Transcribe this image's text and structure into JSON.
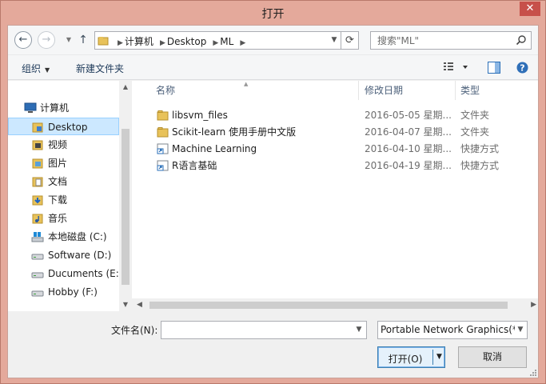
{
  "window": {
    "title": "打开",
    "close_glyph": "✕"
  },
  "address": {
    "crumbs": [
      "计算机",
      "Desktop",
      "ML"
    ],
    "search_placeholder": "搜索\"ML\""
  },
  "toolbar": {
    "organize_label": "组织",
    "new_folder_label": "新建文件夹"
  },
  "navpane": {
    "items": [
      {
        "label": "计算机",
        "icon": "computer-icon"
      },
      {
        "label": "Desktop",
        "icon": "folder-desktop-icon",
        "selected": true
      },
      {
        "label": "视频",
        "icon": "videos-folder-icon"
      },
      {
        "label": "图片",
        "icon": "pictures-folder-icon"
      },
      {
        "label": "文档",
        "icon": "documents-folder-icon"
      },
      {
        "label": "下载",
        "icon": "downloads-folder-icon"
      },
      {
        "label": "音乐",
        "icon": "music-folder-icon"
      },
      {
        "label": "本地磁盘 (C:)",
        "icon": "system-drive-icon"
      },
      {
        "label": "Software (D:)",
        "icon": "drive-icon"
      },
      {
        "label": "Ducuments (E:)",
        "icon": "drive-icon"
      },
      {
        "label": "Hobby (F:)",
        "icon": "drive-icon"
      }
    ]
  },
  "filelist": {
    "columns": {
      "name": "名称",
      "date": "修改日期",
      "type": "类型"
    },
    "rows": [
      {
        "name": "libsvm_files",
        "date": "2016-05-05 星期...",
        "type": "文件夹",
        "icon": "folder-icon"
      },
      {
        "name": "Scikit-learn 使用手册中文版",
        "date": "2016-04-07 星期...",
        "type": "文件夹",
        "icon": "folder-icon"
      },
      {
        "name": "Machine Learning",
        "date": "2016-04-10 星期...",
        "type": "快捷方式",
        "icon": "shortcut-icon"
      },
      {
        "name": "R语言基础",
        "date": "2016-04-19 星期...",
        "type": "快捷方式",
        "icon": "shortcut-icon"
      }
    ]
  },
  "bottom": {
    "filename_label": "文件名(N):",
    "filename_value": "",
    "filetype_value": "Portable Network Graphics(*.png)",
    "open_label": "打开(O)",
    "cancel_label": "取消"
  },
  "colors": {
    "frame": "#e4a99b",
    "close": "#c7504a",
    "selection": "#cce8ff",
    "button_focus": "#3c7fb1"
  }
}
